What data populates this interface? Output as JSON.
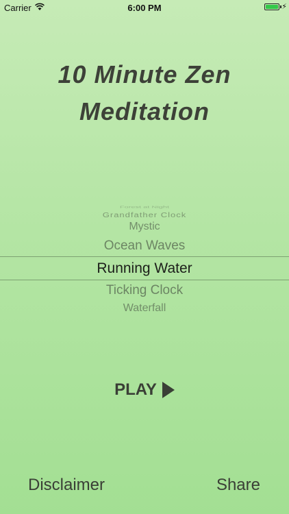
{
  "status_bar": {
    "carrier": "Carrier",
    "time": "6:00 PM",
    "battery_color": "#34c84a"
  },
  "title": {
    "line1": "10 Minute Zen",
    "line2": "Meditation"
  },
  "picker": {
    "items": [
      "Forest at Night",
      "Grandfather Clock",
      "Mystic",
      "Ocean Waves",
      "Running Water",
      "Ticking Clock",
      "Waterfall"
    ],
    "selected": "Running Water"
  },
  "play": {
    "label": "PLAY",
    "icon": "play-triangle-icon"
  },
  "footer": {
    "disclaimer_label": "Disclaimer",
    "share_label": "Share"
  }
}
